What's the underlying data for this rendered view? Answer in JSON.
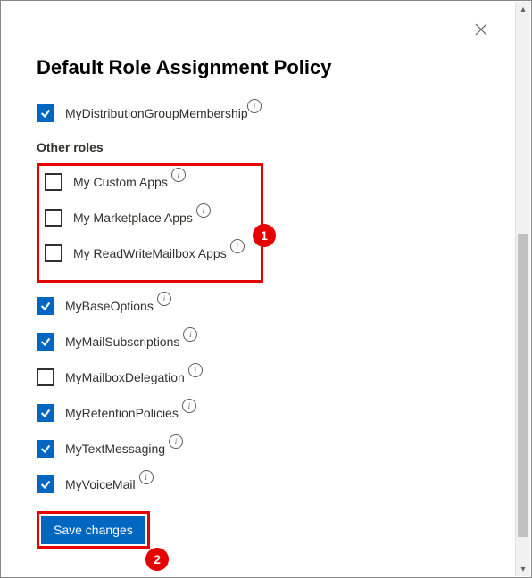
{
  "title": "Default Role Assignment Policy",
  "top_role": {
    "label": "MyDistributionGroupMembership",
    "checked": true
  },
  "other_roles_header": "Other roles",
  "callout_roles": [
    {
      "label": "My Custom Apps",
      "checked": false
    },
    {
      "label": "My Marketplace Apps",
      "checked": false
    },
    {
      "label": "My ReadWriteMailbox Apps",
      "checked": false
    }
  ],
  "roles": [
    {
      "label": "MyBaseOptions",
      "checked": true
    },
    {
      "label": "MyMailSubscriptions",
      "checked": true
    },
    {
      "label": "MyMailboxDelegation",
      "checked": false
    },
    {
      "label": "MyRetentionPolicies",
      "checked": true
    },
    {
      "label": "MyTextMessaging",
      "checked": true
    },
    {
      "label": "MyVoiceMail",
      "checked": true
    }
  ],
  "save_label": "Save changes",
  "annotations": {
    "box1": "1",
    "box2": "2"
  }
}
